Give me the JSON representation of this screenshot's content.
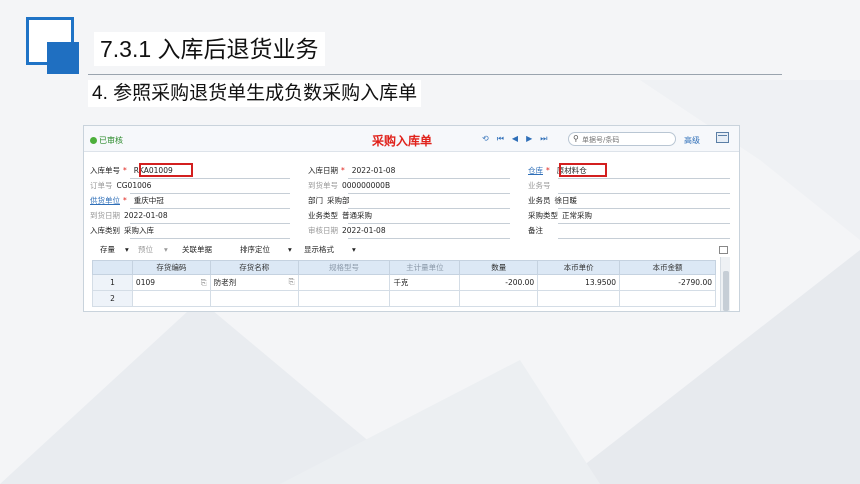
{
  "slide": {
    "title": "7.3.1  入库后退货业务",
    "subtitle": "4. 参照采购退货单生成负数采购入库单"
  },
  "window": {
    "status": "已审核",
    "doc_title": "采购入库单",
    "search_placeholder": "单据号/条码",
    "advanced_label": "高级",
    "nav_icons": [
      "refresh-icon",
      "first-icon",
      "prev-icon",
      "next-icon",
      "last-icon"
    ],
    "header_fields": {
      "receipt_no_label": "入库单号",
      "receipt_no": "RKA01009",
      "order_no_label": "订单号",
      "order_no": "CG01006",
      "supplier_label": "供货单位",
      "supplier": "重庆中冠",
      "arrival_date_label": "到货日期",
      "arrival_date": "2022-01-08",
      "in_type_label": "入库类别",
      "in_type": "采购入库",
      "in_date_label": "入库日期",
      "in_date": "2022-01-08",
      "arrival_no_label": "到货单号",
      "arrival_no": "000000000B",
      "dept_label": "部门",
      "dept": "采购部",
      "biz_type_label": "业务类型",
      "biz_type": "普通采购",
      "audit_date_label": "审核日期",
      "audit_date": "2022-01-08",
      "warehouse_label": "仓库",
      "warehouse": "原材料仓",
      "biz_no_label": "业务号",
      "clerk_label": "业务员",
      "clerk": "徐日暖",
      "purchase_type_label": "采购类型",
      "purchase_type": "正常采购",
      "remark_label": "备注"
    },
    "grid_toolbar": [
      "存量",
      "▾",
      "预位",
      "▾",
      "关联单据",
      "排序定位",
      "▾",
      "显示格式",
      "▾"
    ],
    "grid": {
      "columns": [
        "",
        "存货编码",
        "存货名称",
        "规格型号",
        "主计量单位",
        "数量",
        "本币单价",
        "本币金额"
      ],
      "rows": [
        [
          "1",
          "0109",
          "防老剂",
          "",
          "千克",
          "-200.00",
          "13.9500",
          "-2790.00"
        ],
        [
          "2",
          "",
          "",
          "",
          "",
          "",
          "",
          ""
        ]
      ]
    }
  },
  "colors": {
    "accent": "#1f6fc1",
    "highlight": "#d31f1f",
    "title_red": "#e0221b",
    "status_green": "#4caf3b"
  }
}
